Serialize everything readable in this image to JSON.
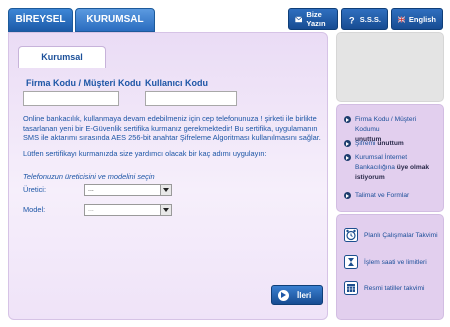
{
  "tabs": {
    "bireysel": "BİREYSEL",
    "kurumsal": "KURUMSAL"
  },
  "top_buttons": {
    "write": "Bize Yazın",
    "faq": "S.S.S.",
    "language": "English"
  },
  "panel": {
    "tab": "Kurumsal",
    "firm_code_label": "Firma Kodu / Müşteri Kodu",
    "firm_code_value": "",
    "user_code_label": "Kullanıcı Kodu",
    "user_code_value": "",
    "info_text": "Online bankacılık, kullanmaya devam edebilmeniz için cep telefonunuza ! şirketi ile birlikte tasarlanan yeni bir E-Güvenlik sertifika kurmanız gerekmektedir! Bu sertifika, uygulamanın SMS ile aktarımı sırasında AES 256-bit anahtar Şifreleme Algoritması kullanılmasını sağlar.",
    "instruction": "Lütfen sertifikayı kurmanızda size yardımcı olacak bir kaç adımı uygulayın:",
    "select_title": "Telefonuzun üreticisini ve modelini seçin",
    "manufacturer_label": "Üretici:",
    "manufacturer_value": "...",
    "model_label": "Model:",
    "model_value": "...",
    "next_button": "İleri"
  },
  "right_links": {
    "forgot_code_1": "Firma Kodu / Müşteri Kodumu",
    "forgot_code_2": "unuttum",
    "forgot_pass_1": "Şifremi ",
    "forgot_pass_2": "unuttum",
    "corporate_1": "Kurumsal İnternet",
    "corporate_2": "Bankacılığına ",
    "corporate_3": "üye olmak",
    "corporate_4": "istiyorum",
    "instructions": "Talimat ve Formlar"
  },
  "right_tools": {
    "calendar": "Planlı Çalışmalar Takvimi",
    "hours": "İşlem saati ve limitleri",
    "holidays": "Resmi tatiller takvimi"
  },
  "colors": {
    "accent": "#1d56a6",
    "panel": "#eadcf5",
    "button": "#174c92"
  }
}
